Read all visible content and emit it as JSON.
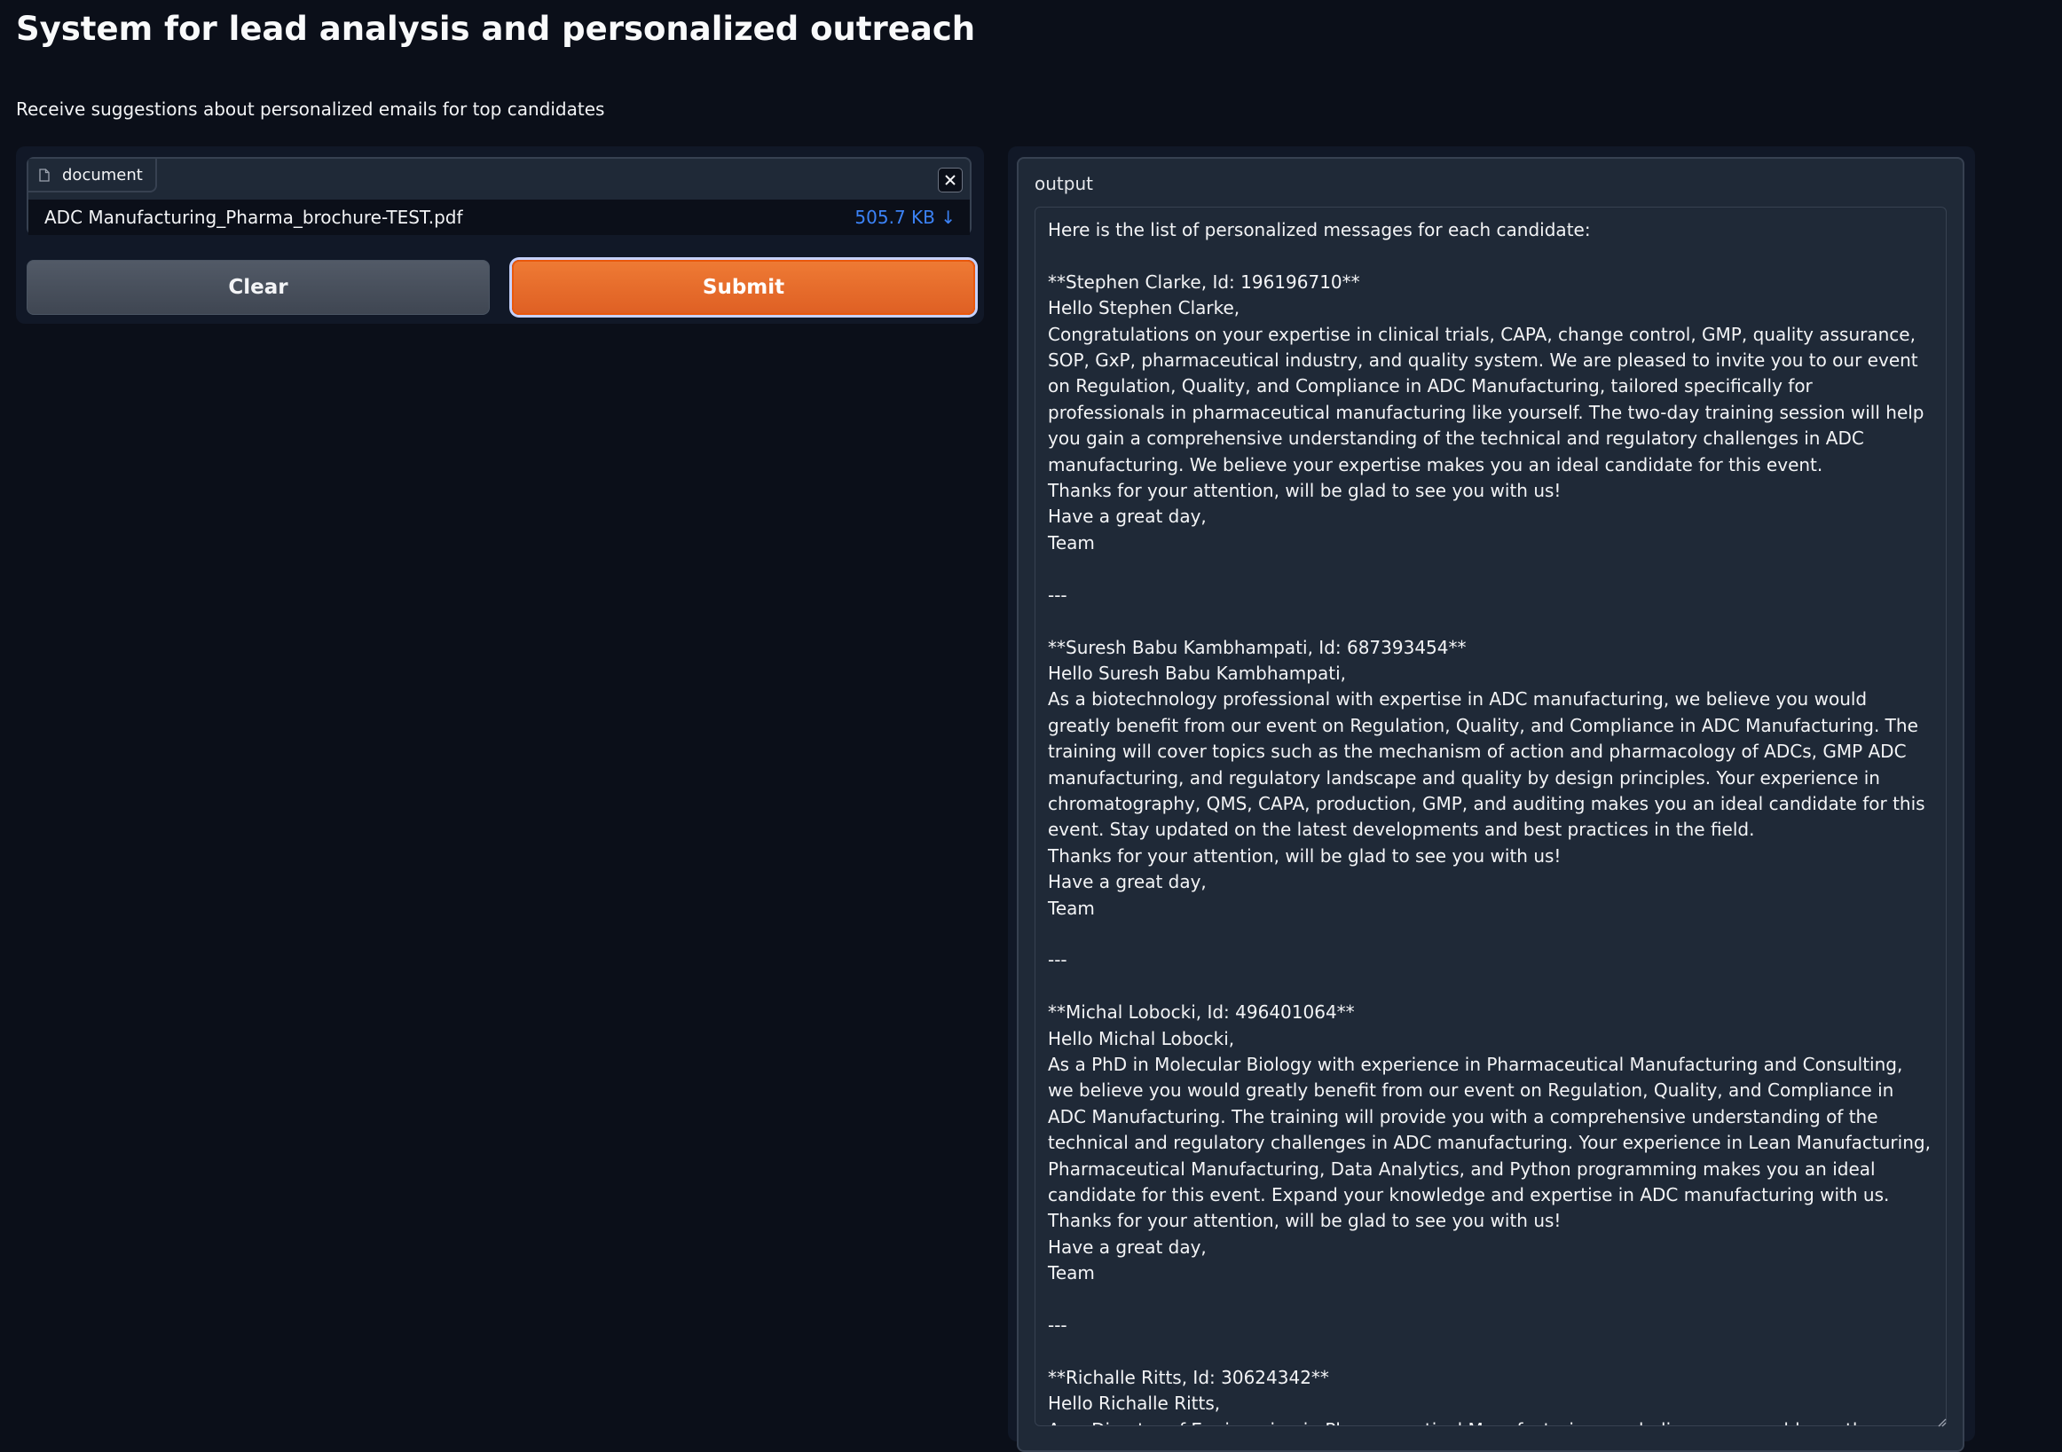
{
  "header": {
    "title": "System for lead analysis and personalized outreach",
    "description": "Receive suggestions about personalized emails for top candidates"
  },
  "file_input": {
    "label": "document",
    "file_name": "ADC Manufacturing_Pharma_brochure-TEST.pdf",
    "file_size": "505.7 KB ↓"
  },
  "buttons": {
    "clear": "Clear",
    "submit": "Submit"
  },
  "output": {
    "label": "output",
    "text": "Here is the list of personalized messages for each candidate:\n\n**Stephen Clarke, Id: 196196710**\nHello Stephen Clarke,\nCongratulations on your expertise in clinical trials, CAPA, change control, GMP, quality assurance, SOP, GxP, pharmaceutical industry, and quality system. We are pleased to invite you to our event on Regulation, Quality, and Compliance in ADC Manufacturing, tailored specifically for professionals in pharmaceutical manufacturing like yourself. The two-day training session will help you gain a comprehensive understanding of the technical and regulatory challenges in ADC manufacturing. We believe your expertise makes you an ideal candidate for this event.\nThanks for your attention, will be glad to see you with us!\nHave a great day,\nTeam\n\n---\n\n**Suresh Babu Kambhampati, Id: 687393454**\nHello Suresh Babu Kambhampati,\nAs a biotechnology professional with expertise in ADC manufacturing, we believe you would greatly benefit from our event on Regulation, Quality, and Compliance in ADC Manufacturing. The training will cover topics such as the mechanism of action and pharmacology of ADCs, GMP ADC manufacturing, and regulatory landscape and quality by design principles. Your experience in chromatography, QMS, CAPA, production, GMP, and auditing makes you an ideal candidate for this event. Stay updated on the latest developments and best practices in the field.\nThanks for your attention, will be glad to see you with us!\nHave a great day,\nTeam\n\n---\n\n**Michal Lobocki, Id: 496401064**\nHello Michal Lobocki,\nAs a PhD in Molecular Biology with experience in Pharmaceutical Manufacturing and Consulting, we believe you would greatly benefit from our event on Regulation, Quality, and Compliance in ADC Manufacturing. The training will provide you with a comprehensive understanding of the technical and regulatory challenges in ADC manufacturing. Your experience in Lean Manufacturing, Pharmaceutical Manufacturing, Data Analytics, and Python programming makes you an ideal candidate for this event. Expand your knowledge and expertise in ADC manufacturing with us.\nThanks for your attention, will be glad to see you with us!\nHave a great day,\nTeam\n\n---\n\n**Richalle Ritts, Id: 30624342**\nHello Richalle Ritts,\nAs a Director of Engineering in Pharmaceutical Manufacturing, we believe you would greatly benefit from our"
  },
  "icons": {
    "file": "file-icon",
    "close": "close-icon",
    "resize": "resize-handle-icon"
  }
}
